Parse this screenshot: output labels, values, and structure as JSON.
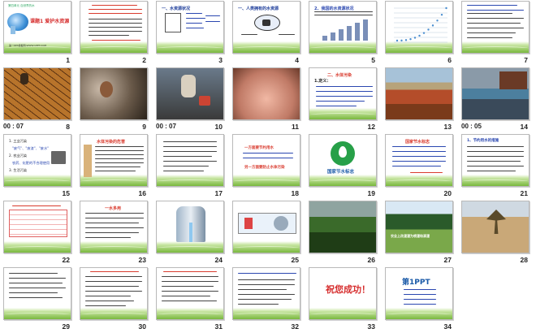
{
  "slides": [
    {
      "num": "1",
      "title": "课题1  爱护水资源",
      "subtitle": "第四单元  自然界的水",
      "footer": "第一PPT模板网-WWW.1PPT.COM"
    },
    {
      "num": "2"
    },
    {
      "num": "3",
      "title": "一、水资源状况"
    },
    {
      "num": "4",
      "title": "一、人类拥有的水资源"
    },
    {
      "num": "5",
      "title": "2、我国的水资源状况"
    },
    {
      "num": "6"
    },
    {
      "num": "7"
    },
    {
      "num": "8",
      "timer": "00 : 07"
    },
    {
      "num": "9"
    },
    {
      "num": "10",
      "timer": "00 : 07"
    },
    {
      "num": "11"
    },
    {
      "num": "12",
      "title": "二、水体污染",
      "lead": "1.定义："
    },
    {
      "num": "13"
    },
    {
      "num": "14",
      "timer": "00 : 05"
    },
    {
      "num": "15",
      "lines": [
        "1. 工业污染",
        "\"废气\"、\"废渣\"、\"废水\"",
        "2. 农业污染",
        "农药、化肥的不合理使用",
        "3. 生活污染"
      ]
    },
    {
      "num": "16",
      "title": "水体污染的危害"
    },
    {
      "num": "17"
    },
    {
      "num": "18",
      "lines": [
        "一方面要节约用水",
        "另一方面要防止水体污染"
      ]
    },
    {
      "num": "19",
      "caption": "国家节水标志"
    },
    {
      "num": "20",
      "title": "国家节水标志"
    },
    {
      "num": "21",
      "lead": "1、节约用水的措施"
    },
    {
      "num": "22"
    },
    {
      "num": "23",
      "title": "一水多用"
    },
    {
      "num": "24"
    },
    {
      "num": "25"
    },
    {
      "num": "26"
    },
    {
      "num": "27",
      "lines": [
        "农业上改漫灌为喷灌和滴灌"
      ]
    },
    {
      "num": "28"
    },
    {
      "num": "29"
    },
    {
      "num": "30"
    },
    {
      "num": "31"
    },
    {
      "num": "32"
    },
    {
      "num": "33",
      "banner": "祝您成功！"
    },
    {
      "num": "34",
      "logo": "第1PPT"
    }
  ],
  "colors": {
    "band_green": "#79b83d",
    "title_blue": "#1c3c9a",
    "emphasis_red": "#d93b2e",
    "thumb_border": "#b9b9b9"
  }
}
